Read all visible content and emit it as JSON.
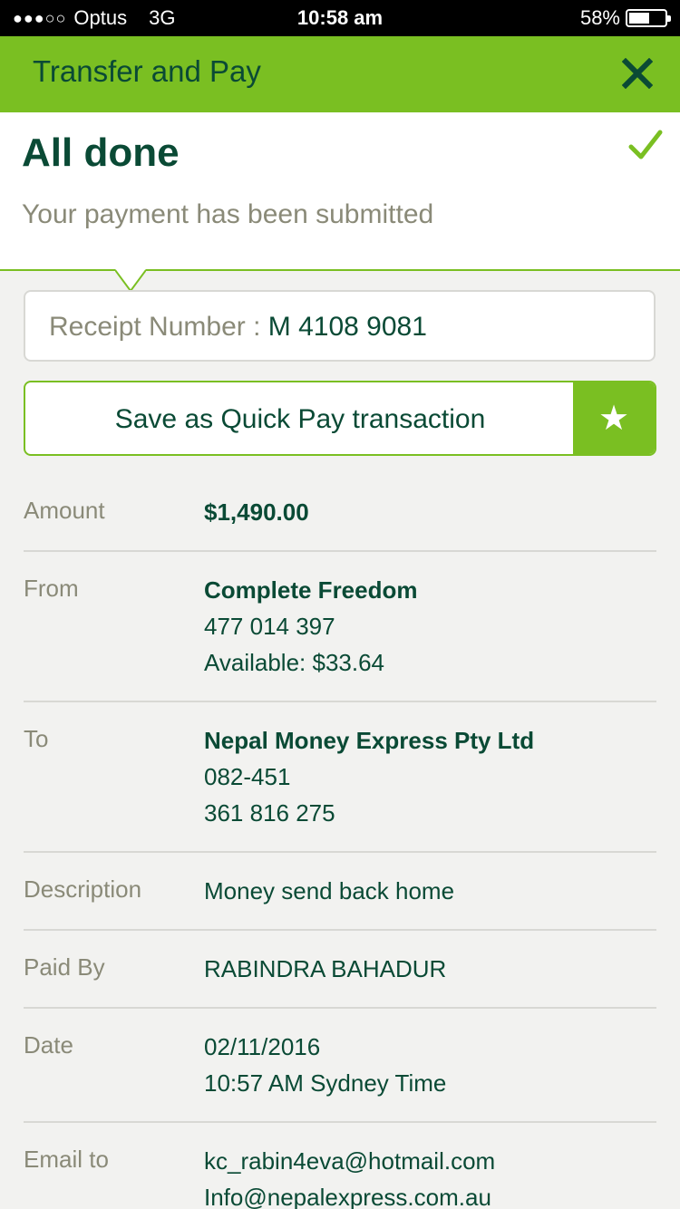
{
  "status_bar": {
    "signal": "●●●○○",
    "carrier": "Optus",
    "network": "3G",
    "time": "10:58 am",
    "battery_percent": "58%",
    "battery_level": 0.58
  },
  "header": {
    "title": "Transfer and Pay",
    "close_icon": "close-icon"
  },
  "confirmation": {
    "title": "All done",
    "subtitle": "Your payment has been submitted",
    "icon": "checkmark-icon"
  },
  "receipt": {
    "label": "Receipt Number : ",
    "value": "M 4108 9081"
  },
  "quick_pay": {
    "label": "Save as Quick Pay transaction",
    "icon": "star-icon"
  },
  "details": {
    "amount": {
      "label": "Amount",
      "value": "$1,490.00"
    },
    "from": {
      "label": "From",
      "name": "Complete Freedom",
      "account": "477 014 397",
      "available": "Available: $33.64"
    },
    "to": {
      "label": "To",
      "name": "Nepal Money Express Pty Ltd",
      "bsb": "082-451",
      "account": "361 816 275"
    },
    "description": {
      "label": "Description",
      "value": "Money send back home"
    },
    "paid_by": {
      "label": "Paid By",
      "value": "RABINDRA BAHADUR"
    },
    "date": {
      "label": "Date",
      "date": "02/11/2016",
      "time": "10:57 AM Sydney Time"
    },
    "email_to": {
      "label": "Email to",
      "email1": "kc_rabin4eva@hotmail.com",
      "email2": "Info@nepalexpress.com.au"
    }
  },
  "colors": {
    "brand_green": "#7abf22",
    "text_dark_green": "#0a4a35",
    "label_gray": "#8a8a78",
    "background": "#f2f2f0"
  }
}
